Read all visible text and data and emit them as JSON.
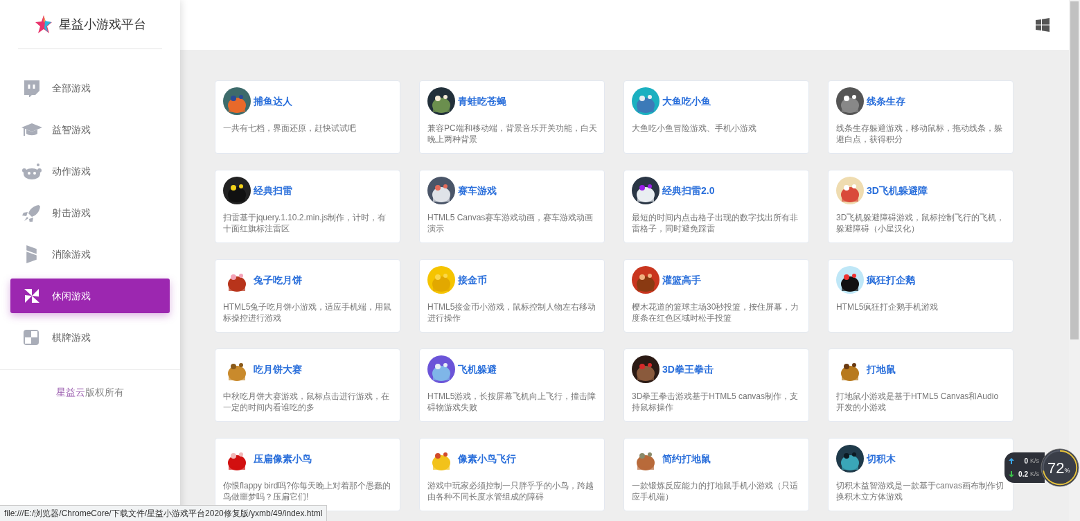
{
  "brand": {
    "title": "星益小游戏平台"
  },
  "sidebar": {
    "items": [
      {
        "label": "全部游戏",
        "selected": false
      },
      {
        "label": "益智游戏",
        "selected": false
      },
      {
        "label": "动作游戏",
        "selected": false
      },
      {
        "label": "射击游戏",
        "selected": false
      },
      {
        "label": "消除游戏",
        "selected": false
      },
      {
        "label": "休闲游戏",
        "selected": true
      },
      {
        "label": "棋牌游戏",
        "selected": false
      }
    ],
    "footer": {
      "brand": "星益云",
      "text": "版权所有"
    }
  },
  "games": [
    {
      "title": "捕鱼达人",
      "description": "一共有七档，界面还原，赶快试试吧"
    },
    {
      "title": "青蛙吃苍蝇",
      "description": "兼容PC端和移动端，背景音乐开关功能，白天晚上两种背景"
    },
    {
      "title": "大鱼吃小鱼",
      "description": "大鱼吃小鱼冒险游戏、手机小游戏"
    },
    {
      "title": "线条生存",
      "description": "线条生存躲避游戏，移动鼠标，拖动线条，躲避白点，获得积分"
    },
    {
      "title": "经典扫雷",
      "description": "扫雷基于jquery.1.10.2.min.js制作，计时，有十面红旗标注雷区"
    },
    {
      "title": "赛车游戏",
      "description": "HTML5 Canvas赛车游戏动画，赛车游戏动画演示"
    },
    {
      "title": "经典扫雷2.0",
      "description": "最短的时间内点击格子出现的数字找出所有非雷格子，同时避免踩雷"
    },
    {
      "title": "3D飞机躲避障",
      "description": "3D飞机躲避障碍游戏，鼠标控制飞行的飞机，躲避障碍（小星汉化）"
    },
    {
      "title": "兔子吃月饼",
      "description": "HTML5兔子吃月饼小游戏，适应手机端，用鼠标操控进行游戏"
    },
    {
      "title": "接金币",
      "description": "HTML5接金币小游戏，鼠标控制人物左右移动进行操作"
    },
    {
      "title": "灌篮高手",
      "description": "樱木花道的篮球主场30秒投篮，按住屏幕，力度条在红色区域时松手投篮"
    },
    {
      "title": "疯狂打企鹅",
      "description": "HTML5疯狂打企鹅手机游戏"
    },
    {
      "title": "吃月饼大赛",
      "description": "中秋吃月饼大赛游戏，鼠标点击进行游戏，在一定的时间内看谁吃的多"
    },
    {
      "title": "飞机躲避",
      "description": "HTML5游戏，长按屏幕飞机向上飞行，撞击障碍物游戏失败"
    },
    {
      "title": "3D拳王拳击",
      "description": "3D拳王拳击游戏基于HTML5 canvas制作，支持鼠标操作"
    },
    {
      "title": "打地鼠",
      "description": "打地鼠小游戏是基于HTML5 Canvas和Audio开发的小游戏"
    },
    {
      "title": "压扁像素小鸟",
      "description": "你恨flappy bird吗?你每天晚上对着那个愚蠢的鸟做噩梦吗？压扁它们!"
    },
    {
      "title": "像素小鸟飞行",
      "description": "游戏中玩家必须控制一只胖乎乎的小鸟，跨越由各种不同长度水管组成的障碍"
    },
    {
      "title": "简约打地鼠",
      "description": "一款锻炼反应能力的打地鼠手机小游戏（只适应手机端）"
    },
    {
      "title": "切积木",
      "description": "切积木益智游戏是一款基于canvas画布制作切换积木立方体游戏"
    }
  ],
  "status_bar": {
    "url": "file:///E:/浏览器/ChromeCore/下载文件/星益小游戏平台2020修复版/yxmb/49/index.html"
  },
  "net_monitor": {
    "upload": "0",
    "upload_unit": "K/s",
    "download": "0.2",
    "download_unit": "K/s",
    "cpu": "72",
    "cpu_unit": "%"
  }
}
